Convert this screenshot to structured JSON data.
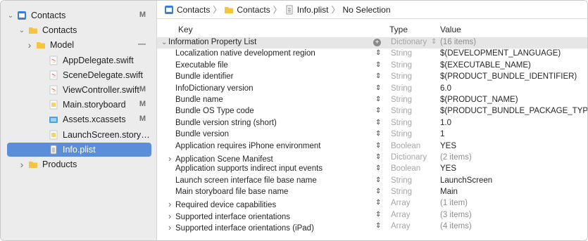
{
  "navigator": {
    "items": [
      {
        "label": "Contacts",
        "badge": "M",
        "icon": "project-icon",
        "disclosure": "down",
        "level": 0
      },
      {
        "label": "Contacts",
        "badge": "",
        "icon": "folder-icon",
        "disclosure": "down",
        "level": 1
      },
      {
        "label": "Model",
        "badge": "—",
        "icon": "folder-icon",
        "disclosure": "right",
        "level": 2
      },
      {
        "label": "AppDelegate.swift",
        "badge": "",
        "icon": "swift-file-icon",
        "disclosure": "",
        "level": 3
      },
      {
        "label": "SceneDelegate.swift",
        "badge": "",
        "icon": "swift-file-icon",
        "disclosure": "",
        "level": 3
      },
      {
        "label": "ViewController.swift",
        "badge": "M",
        "icon": "swift-file-icon",
        "disclosure": "",
        "level": 3
      },
      {
        "label": "Main.storyboard",
        "badge": "M",
        "icon": "storyboard-icon",
        "disclosure": "",
        "level": 3
      },
      {
        "label": "Assets.xcassets",
        "badge": "M",
        "icon": "assets-icon",
        "disclosure": "",
        "level": 3
      },
      {
        "label": "LaunchScreen.storybo...",
        "badge": "",
        "icon": "storyboard-icon",
        "disclosure": "",
        "level": 3
      },
      {
        "label": "Info.plist",
        "badge": "",
        "icon": "plist-icon",
        "disclosure": "",
        "level": 3,
        "selected": true
      },
      {
        "label": "Products",
        "badge": "",
        "icon": "folder-icon",
        "disclosure": "right",
        "level": 1
      }
    ]
  },
  "jumpbar": {
    "crumb1": "Contacts",
    "crumb2": "Contacts",
    "crumb3": "Info.plist",
    "crumb4": "No Selection",
    "separator": "〉"
  },
  "table": {
    "headers": {
      "key": "Key",
      "type": "Type",
      "value": "Value"
    },
    "root": {
      "key": "Information Property List",
      "type": "Dictionary",
      "value": "(16 items)"
    },
    "rows": [
      {
        "key": "Localization native development region",
        "type": "String",
        "value": "$(DEVELOPMENT_LANGUAGE)",
        "expandable": false
      },
      {
        "key": "Executable file",
        "type": "String",
        "value": "$(EXECUTABLE_NAME)",
        "expandable": false
      },
      {
        "key": "Bundle identifier",
        "type": "String",
        "value": "$(PRODUCT_BUNDLE_IDENTIFIER)",
        "expandable": false
      },
      {
        "key": "InfoDictionary version",
        "type": "String",
        "value": "6.0",
        "expandable": false
      },
      {
        "key": "Bundle name",
        "type": "String",
        "value": "$(PRODUCT_NAME)",
        "expandable": false
      },
      {
        "key": "Bundle OS Type code",
        "type": "String",
        "value": "$(PRODUCT_BUNDLE_PACKAGE_TYPE)",
        "expandable": false
      },
      {
        "key": "Bundle version string (short)",
        "type": "String",
        "value": "1.0",
        "expandable": false
      },
      {
        "key": "Bundle version",
        "type": "String",
        "value": "1",
        "expandable": false
      },
      {
        "key": "Application requires iPhone environment",
        "type": "Boolean",
        "value": "YES",
        "expandable": false
      },
      {
        "key": "Application Scene Manifest",
        "type": "Dictionary",
        "value": "(2 items)",
        "expandable": true
      },
      {
        "key": "Application supports indirect input events",
        "type": "Boolean",
        "value": "YES",
        "expandable": false
      },
      {
        "key": "Launch screen interface file base name",
        "type": "String",
        "value": "LaunchScreen",
        "expandable": false
      },
      {
        "key": "Main storyboard file base name",
        "type": "String",
        "value": "Main",
        "expandable": false
      },
      {
        "key": "Required device capabilities",
        "type": "Array",
        "value": "(1 item)",
        "expandable": true
      },
      {
        "key": "Supported interface orientations",
        "type": "Array",
        "value": "(3 items)",
        "expandable": true
      },
      {
        "key": "Supported interface orientations (iPad)",
        "type": "Array",
        "value": "(4 items)",
        "expandable": true
      }
    ]
  },
  "colors": {
    "selection": "#5b8ed9",
    "folder": "#f4c542",
    "swift": "#f05138",
    "assets": "#4aa3df"
  }
}
